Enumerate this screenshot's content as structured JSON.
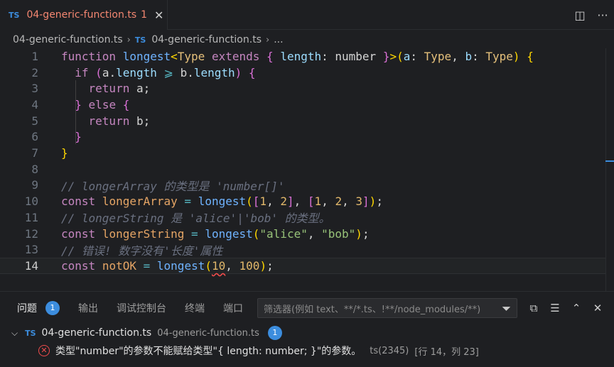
{
  "tab": {
    "badge": "TS",
    "title": "04-generic-function.ts",
    "count": "1",
    "close": "✕"
  },
  "breadcrumb": {
    "file": "04-generic-function.ts",
    "badge": "TS",
    "file2": "04-generic-function.ts",
    "more": "..."
  },
  "editor": {
    "line_numbers": [
      "1",
      "2",
      "3",
      "4",
      "5",
      "6",
      "7",
      "8",
      "9",
      "10",
      "11",
      "12",
      "13",
      "14"
    ],
    "current_line": 14
  },
  "panel": {
    "tabs": [
      "问题",
      "输出",
      "调试控制台",
      "终端",
      "端口"
    ],
    "problems_count": "1",
    "filter_placeholder": "筛选器(例如 text、**/*.ts、!**/node_modules/**)",
    "file_badge": "TS",
    "file_name": "04-generic-function.ts",
    "file_path": "04-generic-function.ts",
    "file_count": "1",
    "message": "类型\"number\"的参数不能赋给类型\"{ length: number; }\"的参数。",
    "message_code": "ts(2345)",
    "message_location": "[行 14，列 23]"
  },
  "colors": {
    "accent": "#3c8dde",
    "error": "#f14c4c",
    "tab_title": "#f48771"
  }
}
